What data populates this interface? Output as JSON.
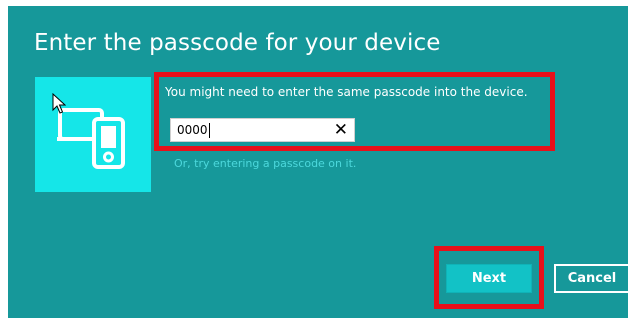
{
  "dialog": {
    "title": "Enter the passcode for your device",
    "instruction": "You might need to enter the same passcode into the device.",
    "passcode_value": "0000",
    "clear_glyph": "✕",
    "alt_link": "Or, try entering a passcode on it.",
    "device_icon": "computer-and-phone-icon"
  },
  "buttons": {
    "next_label": "Next",
    "cancel_label": "Cancel"
  },
  "colors": {
    "dialog_background": "#16989a",
    "tile_background": "#15e6e8",
    "highlight": "#e8101a",
    "link": "#4cd8dc",
    "primary_button": "#12c2c6"
  }
}
